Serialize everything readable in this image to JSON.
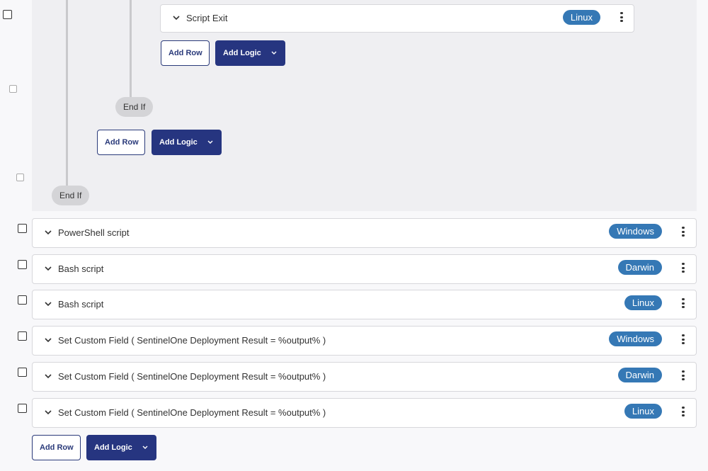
{
  "rows": [
    {
      "title": "Script Exit",
      "os": "Linux"
    },
    {
      "title": "PowerShell script",
      "os": "Windows"
    },
    {
      "title": "Bash script",
      "os": "Darwin"
    },
    {
      "title": "Bash script",
      "os": "Linux"
    },
    {
      "title": "Set Custom Field ( SentinelOne Deployment Result = %output% )",
      "os": "Windows"
    },
    {
      "title": "Set Custom Field ( SentinelOne Deployment Result = %output% )",
      "os": "Darwin"
    },
    {
      "title": "Set Custom Field ( SentinelOne Deployment Result = %output% )",
      "os": "Linux"
    }
  ],
  "buttons": {
    "add_row": "Add Row",
    "add_logic": "Add Logic"
  },
  "end_if": "End If",
  "colors": {
    "badge": "#3578b5",
    "primary": "#263580",
    "nested_bg": "#efeff2"
  }
}
